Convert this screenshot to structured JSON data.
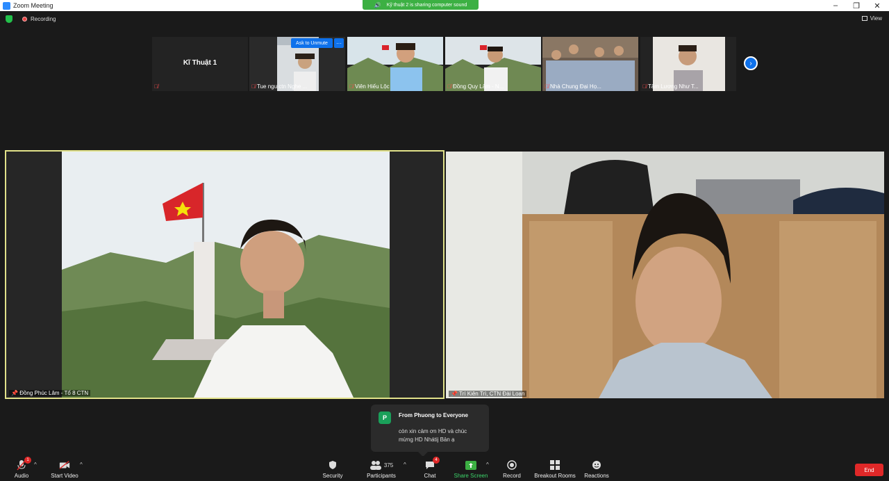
{
  "window": {
    "title": "Zoom Meeting"
  },
  "sharing_banner": "Kỹ thuật 2 is sharing computer sound",
  "status": {
    "recording_label": "Recording",
    "view_label": "View"
  },
  "thumbnails": [
    {
      "name": "Kĩ Thuật 1",
      "muted": true
    },
    {
      "name": "Tue ngu ctn Nghe ...",
      "muted": true
    },
    {
      "name": "Viên Hiếu Lộc",
      "muted": true
    },
    {
      "name": "Đồng Quy Lâm - N...",
      "muted": true
    },
    {
      "name": "Nhà Chung Đại Họ...",
      "muted": true
    },
    {
      "name": "Tâm Lương Như T...",
      "muted": true
    }
  ],
  "ask_to_unmute": "Ask to Unmute",
  "more_options": "···",
  "main_videos": [
    {
      "name": "Đồng Phúc Lâm - Tổ 8 CTN",
      "active_speaker": true
    },
    {
      "name": "Trí Kiên Trì, CTN Đài Loan",
      "active_speaker": false
    }
  ],
  "chat_popup": {
    "avatar_letter": "P",
    "from": "From Phuong to Everyone",
    "message": "còn xin cảm ơn HD và chúc mừng HD Nhátij Bản ạ"
  },
  "toolbar": {
    "audio": "Audio",
    "audio_badge": "1",
    "start_video": "Start Video",
    "security": "Security",
    "participants": "Participants",
    "participants_count": "375",
    "chat": "Chat",
    "chat_badge": "4",
    "share_screen": "Share Screen",
    "record": "Record",
    "breakout_rooms": "Breakout Rooms",
    "reactions": "Reactions",
    "end": "End"
  },
  "colors": {
    "accent_blue": "#0e71eb",
    "share_green": "#3cb043",
    "end_red": "#e02828",
    "active_speaker_border": "#e2e28a"
  }
}
